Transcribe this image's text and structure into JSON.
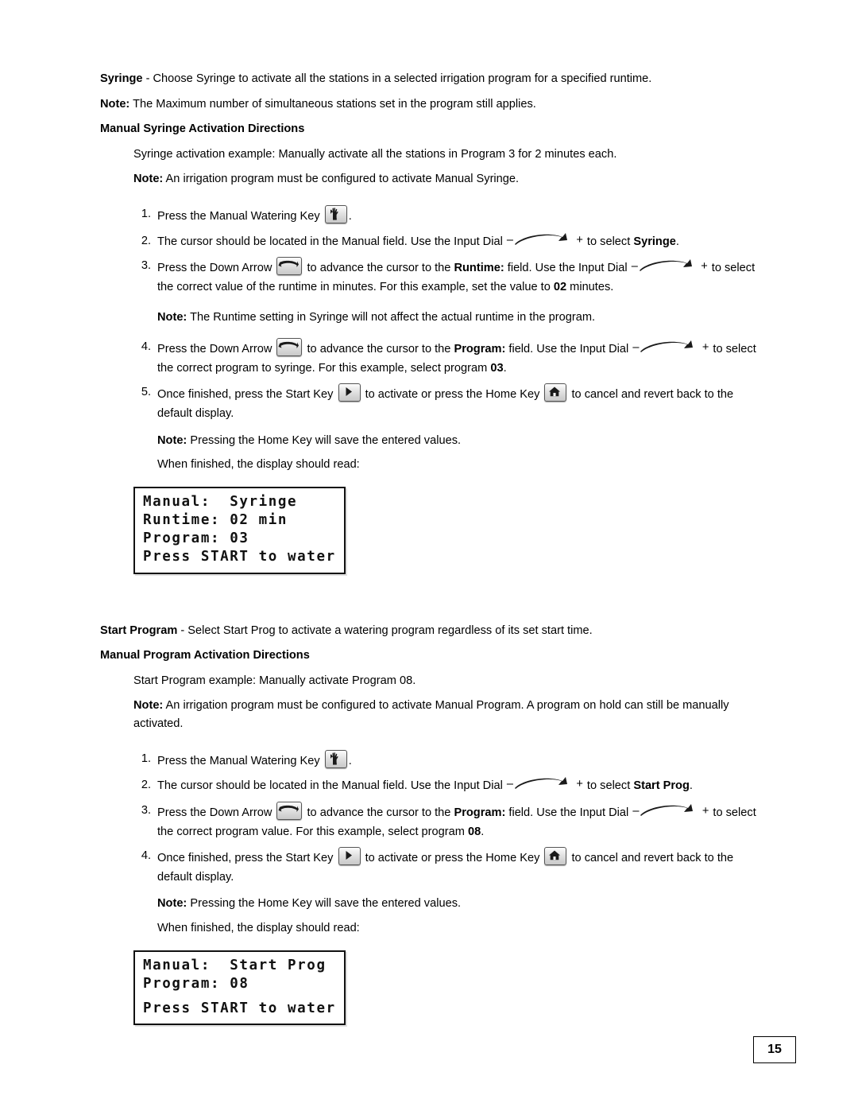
{
  "page": {
    "number": "15"
  },
  "section1": {
    "intro_bold": "Syringe",
    "intro_rest": " - Choose Syringe to activate all the stations in a selected irrigation program for a specified runtime.",
    "note_label": "Note:",
    "note_text": " The Maximum number of simultaneous stations set in the program still applies.",
    "heading": "Manual Syringe Activation Directions",
    "example": "Syringe activation example: Manually activate all the stations in Program 3 for 2 minutes each.",
    "note2_label": "Note:",
    "note2_text": " An irrigation program must be configured to activate Manual Syringe.",
    "steps": [
      {
        "num": "1.",
        "parts": [
          {
            "t": "text",
            "v": "Press the Manual Watering Key "
          },
          {
            "t": "icon",
            "v": "manual-watering-hand-icon"
          },
          {
            "t": "text",
            "v": "."
          }
        ]
      },
      {
        "num": "2.",
        "parts": [
          {
            "t": "text",
            "v": "The cursor should be located in the Manual field. Use the Input Dial "
          },
          {
            "t": "dial",
            "v": "input-dial-icon"
          },
          {
            "t": "text",
            "v": " to select "
          },
          {
            "t": "bold",
            "v": "Syringe"
          },
          {
            "t": "text",
            "v": "."
          }
        ]
      },
      {
        "num": "3.",
        "parts": [
          {
            "t": "text",
            "v": "Press the Down Arrow "
          },
          {
            "t": "icon",
            "v": "down-arrow-icon"
          },
          {
            "t": "text",
            "v": " to advance the cursor to the "
          },
          {
            "t": "bold",
            "v": "Runtime:"
          },
          {
            "t": "text",
            "v": " field. Use the Input Dial "
          },
          {
            "t": "dial",
            "v": "input-dial-icon"
          },
          {
            "t": "text",
            "v": " to select the correct value of the runtime in minutes. For this example, set the value to "
          },
          {
            "t": "bold",
            "v": "02"
          },
          {
            "t": "text",
            "v": " minutes."
          }
        ]
      }
    ],
    "step3_note_label": "Note:",
    "step3_note_text": " The Runtime setting in Syringe will not affect the actual runtime in the program.",
    "step4": {
      "num": "4.",
      "parts": [
        {
          "t": "text",
          "v": "Press the Down Arrow "
        },
        {
          "t": "icon",
          "v": "down-arrow-icon"
        },
        {
          "t": "text",
          "v": " to advance the cursor to the "
        },
        {
          "t": "bold",
          "v": "Program:"
        },
        {
          "t": "text",
          "v": " field. Use the Input Dial "
        },
        {
          "t": "dial",
          "v": "input-dial-icon"
        },
        {
          "t": "text",
          "v": " to select the correct program to syringe. For this example, select program "
        },
        {
          "t": "bold",
          "v": "03"
        },
        {
          "t": "text",
          "v": "."
        }
      ]
    },
    "step5": {
      "num": "5.",
      "parts": [
        {
          "t": "text",
          "v": "Once finished, press the Start Key "
        },
        {
          "t": "icon",
          "v": "start-key-icon"
        },
        {
          "t": "text",
          "v": " to activate or press the Home Key "
        },
        {
          "t": "icon",
          "v": "home-key-icon"
        },
        {
          "t": "text",
          "v": " to cancel and revert back to the default display."
        }
      ]
    },
    "step5_note_label": "Note:",
    "step5_note_text": " Pressing the Home Key will save the entered values.",
    "display_lead": "When finished, the display should read:",
    "lcd_lines": [
      "Manual:  Syringe",
      "Runtime: 02 min",
      "Program: 03",
      "Press START to water"
    ]
  },
  "section2": {
    "intro_bold": "Start Program",
    "intro_rest": " - Select Start Prog to activate a watering program regardless of its set start time.",
    "heading": "Manual Program Activation Directions",
    "example": "Start Program example: Manually activate Program 08.",
    "note_label": "Note:",
    "note_text": " An irrigation program must be configured to activate Manual Program. A program on hold can still be manually activated.",
    "steps": [
      {
        "num": "1.",
        "parts": [
          {
            "t": "text",
            "v": "Press the Manual Watering Key "
          },
          {
            "t": "icon",
            "v": "manual-watering-hand-icon"
          },
          {
            "t": "text",
            "v": "."
          }
        ]
      },
      {
        "num": "2.",
        "parts": [
          {
            "t": "text",
            "v": "The cursor should be located in the Manual field. Use the Input Dial "
          },
          {
            "t": "dial",
            "v": "input-dial-icon"
          },
          {
            "t": "text",
            "v": " to select "
          },
          {
            "t": "bold",
            "v": "Start Prog"
          },
          {
            "t": "text",
            "v": "."
          }
        ]
      },
      {
        "num": "3.",
        "parts": [
          {
            "t": "text",
            "v": "Press the Down Arrow "
          },
          {
            "t": "icon",
            "v": "down-arrow-icon"
          },
          {
            "t": "text",
            "v": " to advance the cursor to the "
          },
          {
            "t": "bold",
            "v": "Program:"
          },
          {
            "t": "text",
            "v": " field. Use the Input Dial "
          },
          {
            "t": "dial",
            "v": "input-dial-icon"
          },
          {
            "t": "text",
            "v": " to select the correct program value. For this example, select program "
          },
          {
            "t": "bold",
            "v": "08"
          },
          {
            "t": "text",
            "v": "."
          }
        ]
      },
      {
        "num": "4.",
        "parts": [
          {
            "t": "text",
            "v": "Once finished, press the Start Key "
          },
          {
            "t": "icon",
            "v": "start-key-icon"
          },
          {
            "t": "text",
            "v": " to activate or press the Home Key "
          },
          {
            "t": "icon",
            "v": "home-key-icon"
          },
          {
            "t": "text",
            "v": " to cancel and revert back to the default display."
          }
        ]
      }
    ],
    "step4_note_label": "Note:",
    "step4_note_text": " Pressing the Home Key will save the entered values.",
    "display_lead": "When finished, the display should read:",
    "lcd_lines": [
      "Manual:  Start Prog",
      "Program: 08",
      "",
      "Press START to water"
    ]
  }
}
